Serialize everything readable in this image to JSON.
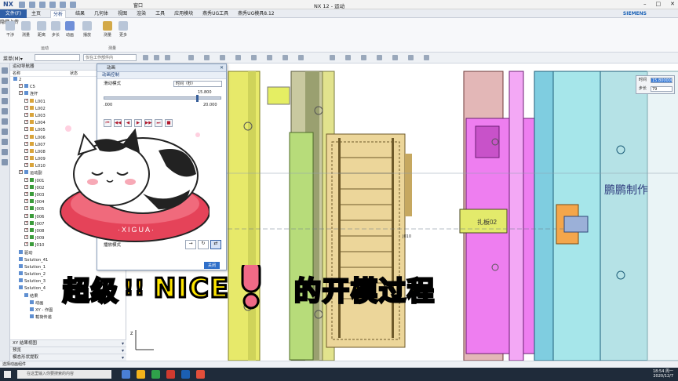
{
  "app": {
    "logo": "NX",
    "window_menu": "窗口",
    "title": "NX 12 - 运动",
    "brand": "SIEMENS",
    "upload": "隐藏上传"
  },
  "tabs": {
    "file": "文件(F)",
    "items": [
      "主页",
      "分析",
      "结果",
      "几何体",
      "视图",
      "渲染",
      "工具",
      "应用模块",
      "燕秀UG工具",
      "燕秀UG模具8.12"
    ],
    "active": "分析"
  },
  "ribbon": {
    "buttons": [
      "干涉",
      "测量",
      "距离",
      "步长",
      "动画",
      "播放",
      "测量",
      "更多"
    ],
    "groups": [
      "运动",
      "测量"
    ]
  },
  "toolbar": {
    "menu": "菜单(M)▾",
    "filter": "仅在工作部件内"
  },
  "navigator": {
    "title": "运动导航器",
    "col_name": "名称",
    "col_state": "状态",
    "tree": [
      "2",
      "C5",
      "连杆",
      "L001",
      "L002",
      "L003",
      "L004",
      "L005",
      "L006",
      "L007",
      "L008",
      "L009",
      "L010",
      "运动副",
      "J001",
      "J002",
      "J003",
      "J004",
      "J005",
      "J006",
      "J007",
      "J008",
      "J009",
      "J010",
      "驱动",
      "Solution_41",
      "Solution_1",
      "Solution_2",
      "Solution_3",
      "Solution_4",
      "结果",
      "动画",
      "XY - 作图",
      "载荷传递"
    ],
    "footer": [
      "XY 结果视图",
      "预览",
      "模态形状提取"
    ]
  },
  "dialog": {
    "title": "动画",
    "section": "动画控制",
    "mode_label": "滑动模式",
    "mode_value": "时间（秒）",
    "slider_current": "15.800",
    "slider_min": ".000",
    "slider_max": "20.000",
    "playback_label": "播放模式",
    "count": "1000",
    "buttons": "关闭",
    "cancel": "取消"
  },
  "overlay": {
    "part1": "超级",
    "bang": "!!",
    "nice": "NICE",
    "part2": "的开模过程",
    "cat_text": "·XIGUA·"
  },
  "watermark": "鹏鹏制作",
  "timepanel": {
    "time_label": "时间",
    "time_value": "15.800000",
    "step_label": "步长",
    "step_value": "79"
  },
  "model_labels": {
    "sign": "扎板02",
    "slot": "J010"
  },
  "statusbar": "选择动画组件",
  "taskbar": {
    "search": "在这里输入你要搜索的内容",
    "time": "18:54 周一",
    "date": "2020/12/7"
  }
}
